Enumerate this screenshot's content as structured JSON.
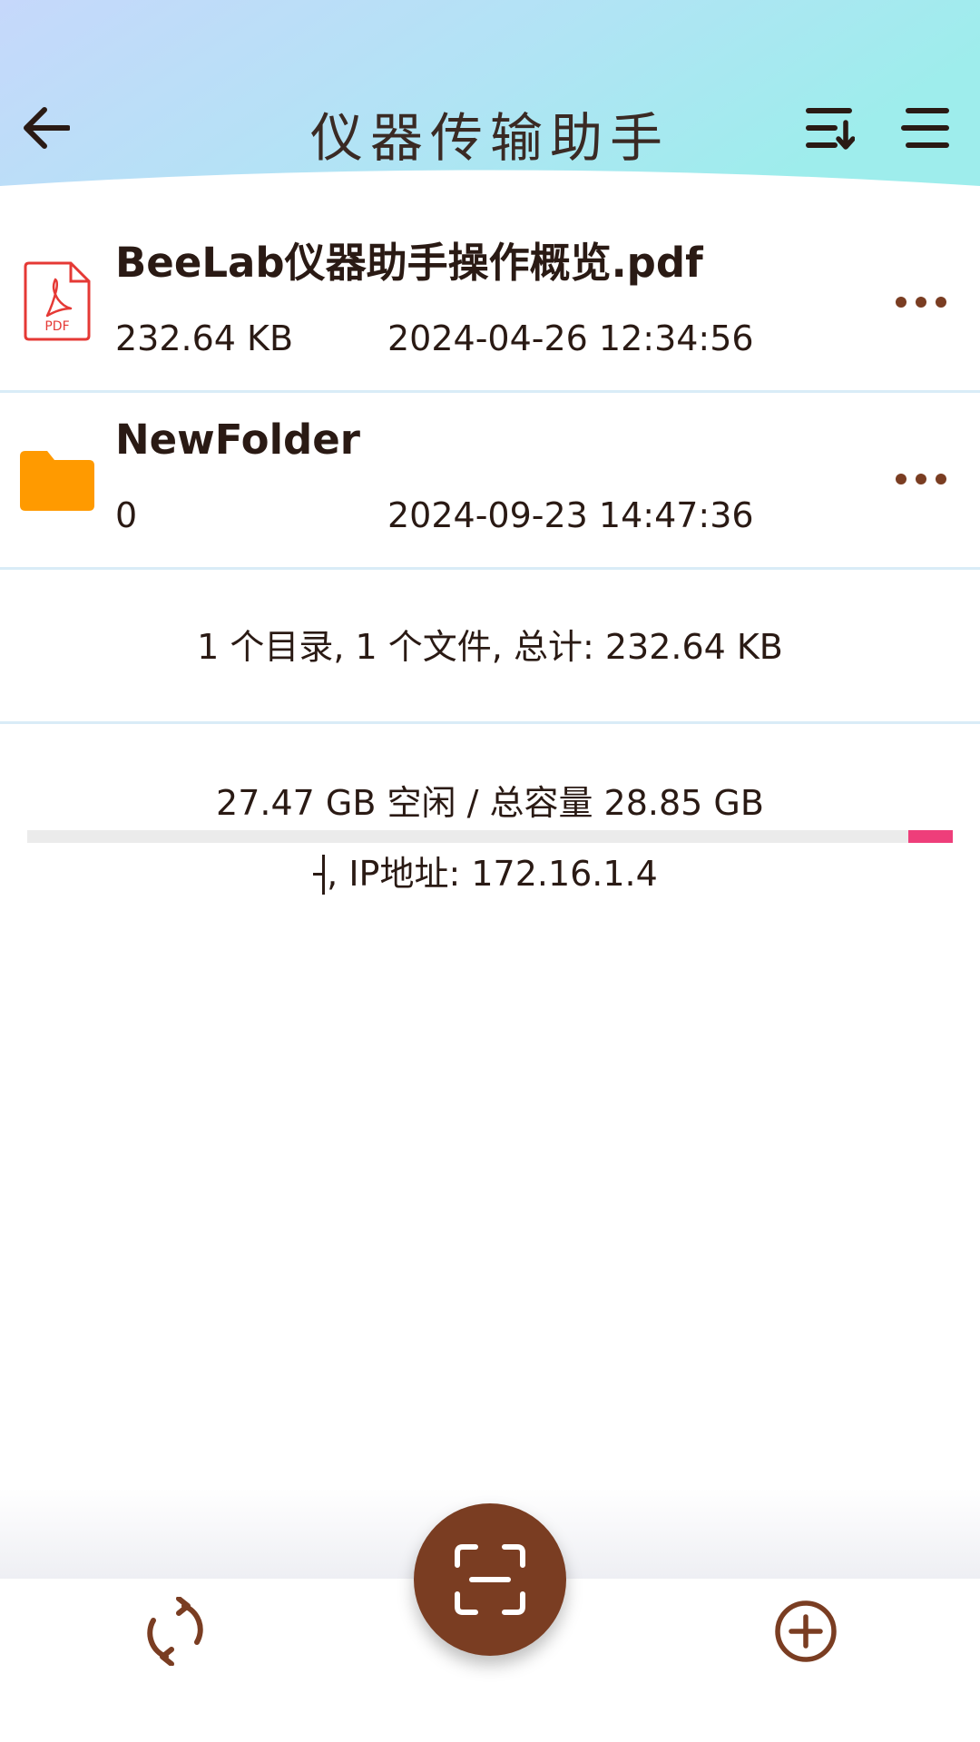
{
  "header": {
    "title": "仪器传输助手",
    "icons": [
      "arrow-back-icon",
      "sort-icon",
      "menu-icon"
    ]
  },
  "files": [
    {
      "name": "BeeLab仪器助手操作概览.pdf",
      "size": "232.64 KB",
      "date": "2024-04-26 12:34:56",
      "icon": "pdf-file-icon",
      "icon_label": "PDF"
    },
    {
      "name": "NewFolder",
      "size": "0",
      "date": "2024-09-23 14:47:36",
      "icon": "folder-icon"
    }
  ],
  "summary": {
    "text": "1 个目录, 1 个文件, 总计: 232.64 KB"
  },
  "storage": {
    "text": "27.47 GB 空闲 / 总容量 28.85 GB",
    "free_gb": 27.47,
    "total_gb": 28.85,
    "ip_text": ", IP地址: 172.16.1.4"
  },
  "bottom_nav": {
    "icons": [
      "refresh-icon",
      "scan-icon",
      "add-circle-icon"
    ]
  },
  "colors": {
    "accent_brown": "#7a3d22",
    "folder_orange": "#ff9a00",
    "pdf_red": "#e53935",
    "storage_used": "#ee3e7a",
    "header_gradient_start": "#c6d8fb",
    "header_gradient_end": "#9eedec"
  }
}
